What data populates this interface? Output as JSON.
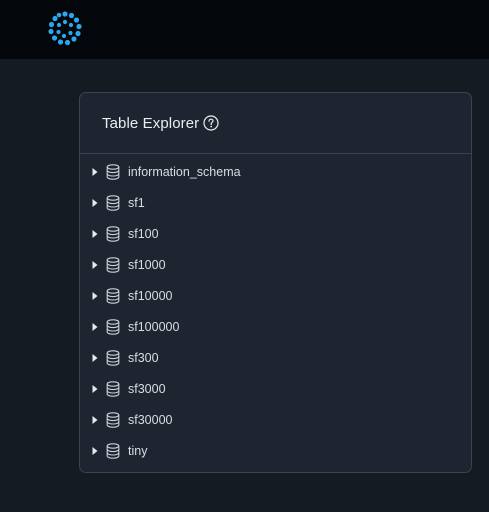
{
  "header": {
    "logo_icon": "cluster-dots-logo",
    "accent_color": "#29a9ec"
  },
  "table_explorer": {
    "title": "Table Explorer",
    "help_icon": "question-circle-icon",
    "items": [
      {
        "label": "information_schema",
        "icon": "database-icon"
      },
      {
        "label": "sf1",
        "icon": "database-icon"
      },
      {
        "label": "sf100",
        "icon": "database-icon"
      },
      {
        "label": "sf1000",
        "icon": "database-icon"
      },
      {
        "label": "sf10000",
        "icon": "database-icon"
      },
      {
        "label": "sf100000",
        "icon": "database-icon"
      },
      {
        "label": "sf300",
        "icon": "database-icon"
      },
      {
        "label": "sf3000",
        "icon": "database-icon"
      },
      {
        "label": "sf30000",
        "icon": "database-icon"
      },
      {
        "label": "tiny",
        "icon": "database-icon"
      }
    ]
  }
}
